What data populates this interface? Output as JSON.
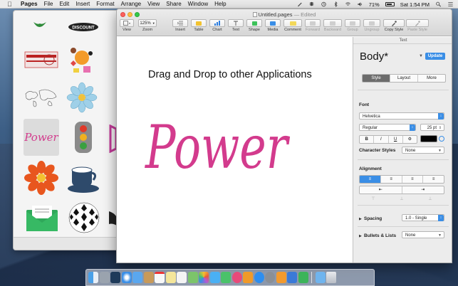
{
  "menubar": {
    "app_name": "Pages",
    "items": [
      "File",
      "Edit",
      "Insert",
      "Format",
      "Arrange",
      "View",
      "Share",
      "Window",
      "Help"
    ],
    "battery": "71%",
    "clock": "Sat 1:54 PM"
  },
  "clip_window": {
    "power_thumb_label": "Power",
    "discount_label": "DISCOUNT"
  },
  "window": {
    "doc_title": "Untitled.pages",
    "status": "— Edited"
  },
  "toolbar": {
    "view": "View",
    "zoom_value": "125%",
    "zoom": "Zoom",
    "insert": "Insert",
    "table": "Table",
    "chart": "Chart",
    "text": "Text",
    "shape": "Shape",
    "media": "Media",
    "comment": "Comment",
    "forward": "Forward",
    "backward": "Backward",
    "group": "Group",
    "ungroup": "Ungroup",
    "copy_style": "Copy Style",
    "paste_style": "Paste Style"
  },
  "canvas": {
    "headline": "Drag and Drop to other Applications",
    "art_text": "Power"
  },
  "inspector": {
    "header": "Text",
    "style_name": "Body*",
    "update": "Update",
    "tabs": [
      "Style",
      "Layout",
      "More"
    ],
    "font_label": "Font",
    "font_family": "Helvetica",
    "font_weight": "Regular",
    "font_size": "25 pt",
    "format_buttons": [
      "B",
      "I",
      "U"
    ],
    "char_styles_label": "Character Styles",
    "char_styles_value": "None",
    "alignment_label": "Alignment",
    "spacing_label": "Spacing",
    "spacing_value": "1.0 - Single",
    "bullets_label": "Bullets & Lists",
    "bullets_value": "None"
  },
  "colors": {
    "accent": "#3a8ee6",
    "power_pink": "#d33b8d"
  },
  "dock_icons": [
    "finder-icon",
    "launchpad-icon",
    "mission-control-icon",
    "safari-icon",
    "mail-icon",
    "contacts-icon",
    "calendar-icon",
    "notes-icon",
    "reminders-icon",
    "maps-icon",
    "photos-icon",
    "messages-icon",
    "facetime-icon",
    "itunes-icon",
    "ibooks-icon",
    "app-store-icon",
    "system-preferences-icon",
    "pages-icon",
    "keynote-icon",
    "numbers-icon",
    "downloads-icon",
    "trash-icon"
  ]
}
